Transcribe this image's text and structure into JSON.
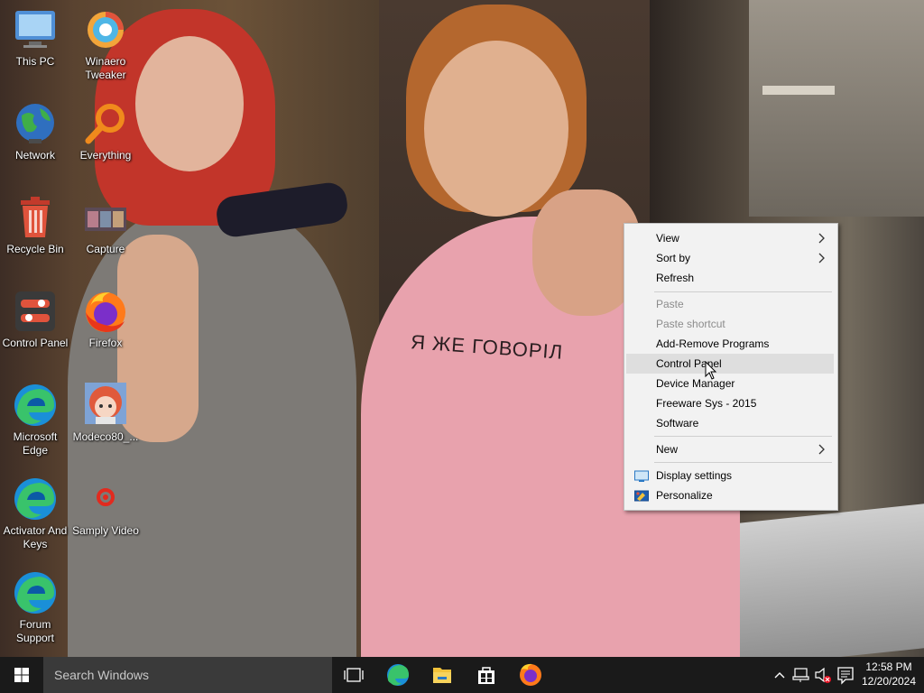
{
  "desktop": {
    "icons": [
      {
        "label": "This PC",
        "icon": "this-pc-icon"
      },
      {
        "label": "Winaero Tweaker",
        "icon": "winaero-tweaker-icon"
      },
      {
        "label": "Network",
        "icon": "network-icon"
      },
      {
        "label": "Everything",
        "icon": "everything-search-icon"
      },
      {
        "label": "Recycle Bin",
        "icon": "recycle-bin-icon"
      },
      {
        "label": "Capture",
        "icon": "capture-image-icon"
      },
      {
        "label": "Control Panel",
        "icon": "control-panel-icon"
      },
      {
        "label": "Firefox",
        "icon": "firefox-icon"
      },
      {
        "label": "Microsoft Edge",
        "icon": "edge-icon"
      },
      {
        "label": "Modeco80_...",
        "icon": "anime-image-icon"
      },
      {
        "label": "Activator And Keys",
        "icon": "edge-icon"
      },
      {
        "label": "Samply Video",
        "icon": "video-icon"
      },
      {
        "label": "Forum Support",
        "icon": "edge-icon"
      }
    ],
    "wallpaper_text": "Я ЖЕ ГОВОРІЛ"
  },
  "context_menu": {
    "items": [
      {
        "label": "View",
        "submenu": true
      },
      {
        "label": "Sort by",
        "submenu": true
      },
      {
        "label": "Refresh"
      },
      {
        "label": "Paste",
        "disabled": true
      },
      {
        "label": "Paste shortcut",
        "disabled": true
      },
      {
        "label": "Add-Remove Programs"
      },
      {
        "label": "Control Panel",
        "highlighted": true
      },
      {
        "label": "Device Manager"
      },
      {
        "label": "Freeware Sys - 2015"
      },
      {
        "label": "Software"
      },
      {
        "label": "New",
        "submenu": true
      },
      {
        "label": "Display settings",
        "icon": "display-settings-icon"
      },
      {
        "label": "Personalize",
        "icon": "personalize-icon"
      }
    ]
  },
  "taskbar": {
    "search_placeholder": "Search Windows",
    "pinned": [
      "task-view-icon",
      "edge-icon",
      "file-explorer-icon",
      "store-icon",
      "firefox-icon"
    ],
    "tray_icons": [
      "chevron-up-icon",
      "network-icon",
      "volume-muted-icon",
      "notification-icon"
    ],
    "time": "12:58 PM",
    "date": "12/20/2024"
  },
  "colors": {
    "taskbar_bg": "#1a1a1a",
    "search_bg": "#3a3a3a",
    "menu_bg": "#f2f2f2",
    "menu_highlight": "#dedede",
    "disabled_text": "#8c8c8c"
  }
}
